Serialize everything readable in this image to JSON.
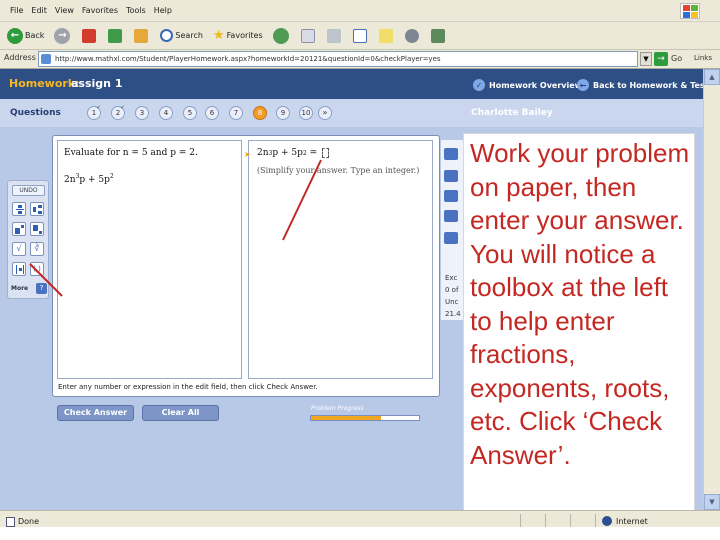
{
  "browser": {
    "menu": [
      "File",
      "Edit",
      "View",
      "Favorites",
      "Tools",
      "Help"
    ],
    "toolbar": {
      "back_label": "Back",
      "search_label": "Search",
      "favorites_label": "Favorites"
    },
    "address": {
      "label": "Address",
      "url": "http://www.mathxl.com/Student/PlayerHomework.aspx?homeworkId=20121&questionId=0&checkPlayer=yes",
      "go_label": "Go",
      "links_label": "Links"
    },
    "status": {
      "text": "Done",
      "zone": "Internet"
    }
  },
  "homework": {
    "title": "Homework:",
    "assignment": "assign 1",
    "links": [
      {
        "label": "Homework Overview",
        "icon": "overview-icon"
      },
      {
        "label": "Back to Homework & Tests",
        "icon": "back-arrow-icon"
      }
    ],
    "questions_label": "Questions",
    "question_numbers": [
      "1",
      "2",
      "3",
      "4",
      "5",
      "6",
      "7",
      "8",
      "9",
      "10"
    ],
    "current_question": "8",
    "student_name": "Charlotte Bailey"
  },
  "exercise": {
    "prompt": "Evaluate for n = 5 and p = 2.",
    "expression": {
      "coef": "2n",
      "exp1": "3",
      "mid": "p + 5p",
      "exp2": "2"
    },
    "answer": {
      "coef": "2n",
      "exp1": "3",
      "mid": "p + 5p",
      "exp2": "2",
      "eq": " = "
    },
    "answer_hint": "(Simplify your answer. Type an integer.)",
    "instruction": "Enter any number or expression in the edit field, then click Check Answer.",
    "toolbox": {
      "undo_label": "UNDO",
      "more_label": "More",
      "help_label": "?"
    },
    "check_answer_label": "Check Answer",
    "clear_all_label": "Clear All",
    "progress_label": "Problem Progress",
    "progress_fraction": 0.65
  },
  "side_panel": {
    "items": [
      "Exc",
      "0 of",
      "Unc",
      "21.4"
    ]
  },
  "callout": {
    "text": "Work your problem on paper, then enter your answer. You will notice a toolbox at the left to help enter fractions, exponents, roots, etc.  Click ‘Check Answer’."
  },
  "colors": {
    "header_bg": "#2e4e86",
    "title_accent": "#f5b820",
    "callout_text": "#c42823",
    "arrow": "#c42823",
    "current_question": "#f39c2a"
  }
}
